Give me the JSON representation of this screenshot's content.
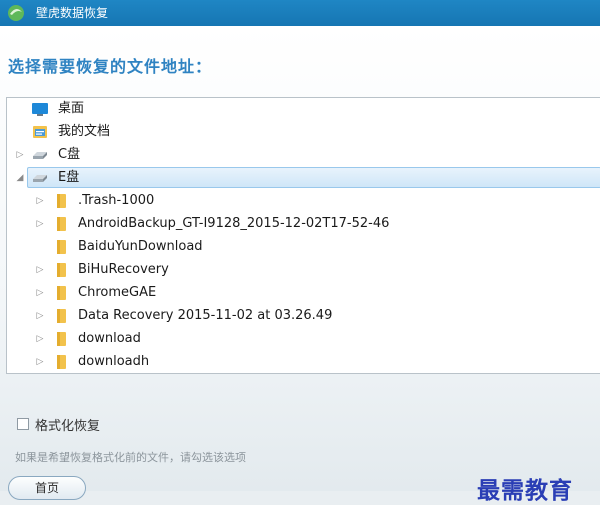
{
  "window": {
    "title": "壁虎数据恢复"
  },
  "heading": "选择需要恢复的文件地址：",
  "tree": {
    "items": [
      {
        "label": "桌面",
        "icon": "desktop-icon",
        "level": 0,
        "expander": "none"
      },
      {
        "label": "我的文档",
        "icon": "documents-icon",
        "level": 0,
        "expander": "none"
      },
      {
        "label": "C盘",
        "icon": "drive-icon",
        "level": 0,
        "expander": "collapsed"
      },
      {
        "label": "E盘",
        "icon": "drive-icon",
        "level": 0,
        "expander": "expanded",
        "selected": true
      },
      {
        "label": ".Trash-1000",
        "icon": "folder-icon",
        "level": 1,
        "expander": "collapsed"
      },
      {
        "label": "AndroidBackup_GT-I9128_2015-12-02T17-52-46",
        "icon": "folder-icon",
        "level": 1,
        "expander": "collapsed"
      },
      {
        "label": "BaiduYunDownload",
        "icon": "folder-icon",
        "level": 1,
        "expander": "none"
      },
      {
        "label": "BiHuRecovery",
        "icon": "folder-icon",
        "level": 1,
        "expander": "collapsed"
      },
      {
        "label": "ChromeGAE",
        "icon": "folder-icon",
        "level": 1,
        "expander": "collapsed"
      },
      {
        "label": "Data Recovery 2015-11-02 at 03.26.49",
        "icon": "folder-icon",
        "level": 1,
        "expander": "collapsed"
      },
      {
        "label": "download",
        "icon": "folder-icon",
        "level": 1,
        "expander": "collapsed"
      },
      {
        "label": "downloadh",
        "icon": "folder-icon",
        "level": 1,
        "expander": "collapsed"
      },
      {
        "label": "",
        "icon": "folder-icon",
        "level": 1,
        "expander": "collapsed"
      }
    ]
  },
  "format_option": {
    "label": "格式化恢复",
    "checked": false
  },
  "hint": "如果是希望恢复格式化前的文件，请勾选该选项",
  "watermark": "最需教育",
  "home_button": {
    "label": "首页"
  },
  "colors": {
    "titlebar": "#1a7ebc",
    "heading": "#2f83c2",
    "selection": "#cfe6f8",
    "folder": "#f2c24c",
    "watermark": "#2a3eb5"
  }
}
